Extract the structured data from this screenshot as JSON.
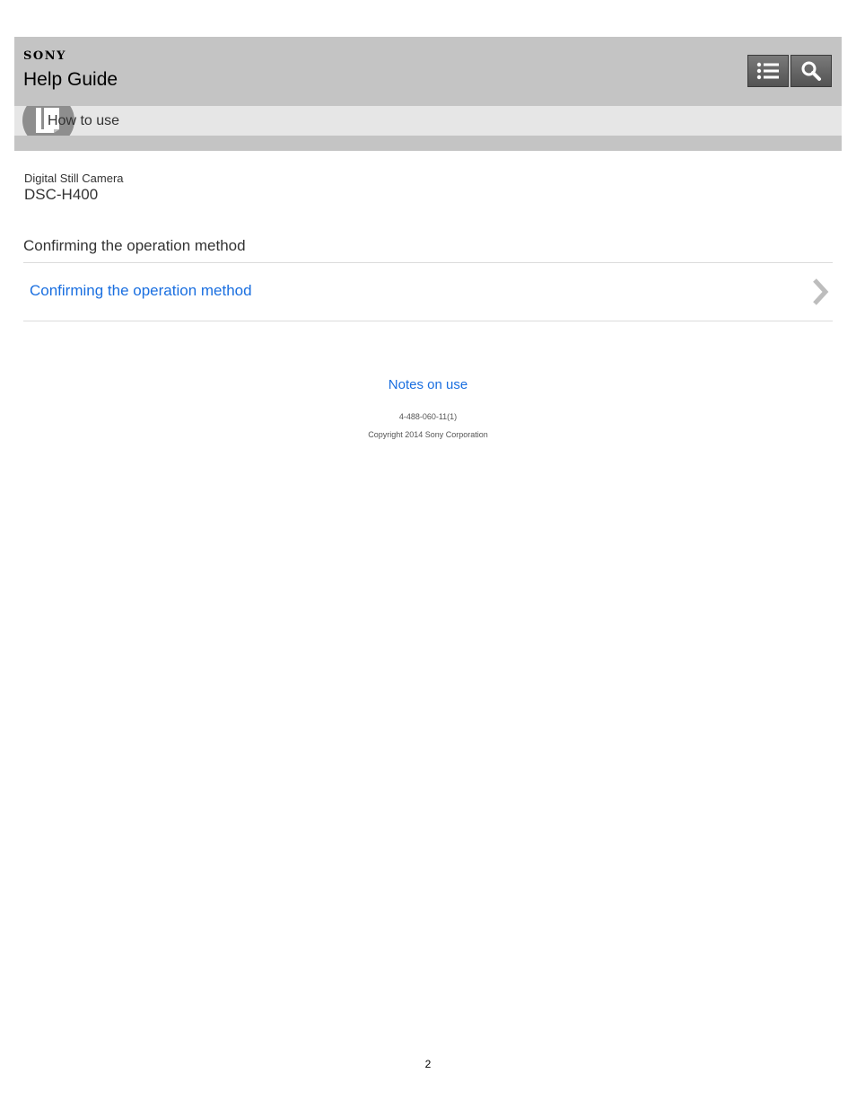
{
  "header": {
    "brand": "SONY",
    "title": "Help Guide",
    "list_button_icon": "list-icon",
    "search_button_icon": "search-icon"
  },
  "subnav": {
    "label": "How to use",
    "icon": "book-icon"
  },
  "product": {
    "type": "Digital Still Camera",
    "model": "DSC-H400"
  },
  "section": {
    "title": "Confirming the operation method",
    "items": [
      {
        "label": "Confirming the operation method",
        "icon": "chevron-right-icon"
      }
    ]
  },
  "footer": {
    "notes_link": "Notes on use",
    "doc_number": "4-488-060-11(1)",
    "copyright": "Copyright 2014 Sony Corporation",
    "page_number": "2"
  },
  "colors": {
    "header_bg": "#c4c4c4",
    "subnav_bg": "#e6e6e6",
    "link": "#1a6fe0",
    "text": "#333333"
  }
}
